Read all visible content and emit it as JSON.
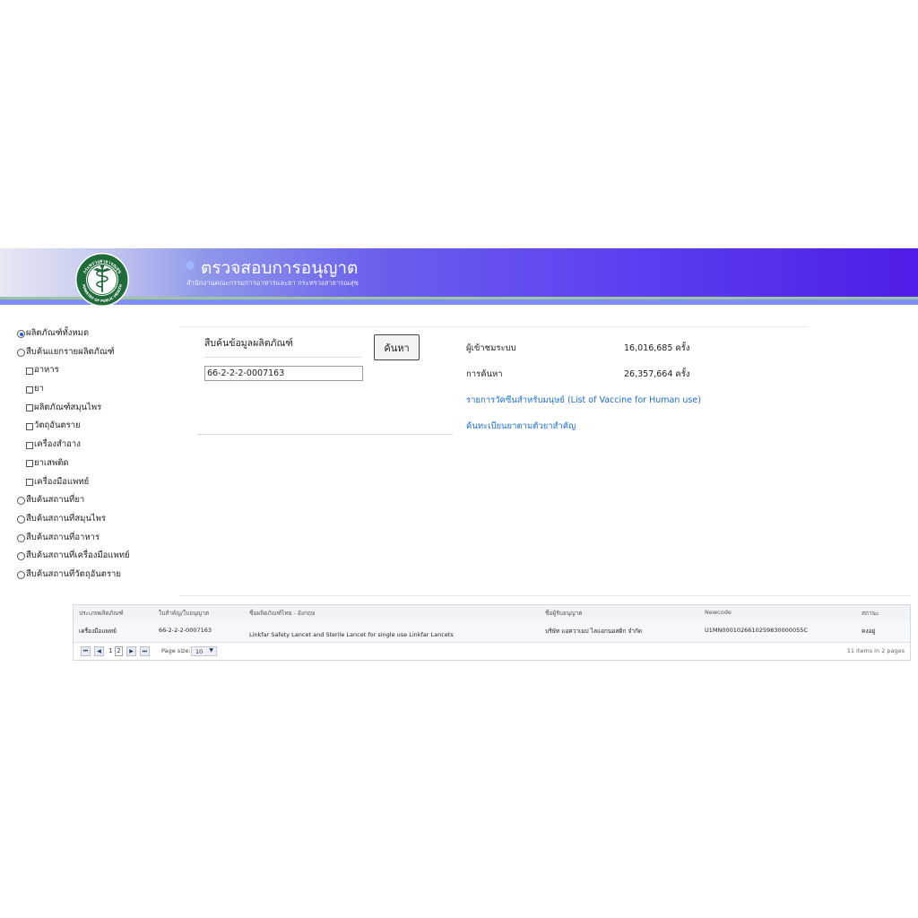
{
  "header": {
    "title": "ตรวจสอบการอนุญาต",
    "subtitle": "สำนักงานคณะกรรมการอาหารและยา กระทรวงสาธารณสุข",
    "logo_icon": "moph-seal-icon",
    "logo_text_top": "กระทรวงสาธารณสุข",
    "logo_text_bottom": "MINISTRY OF PUBLIC HEALTH"
  },
  "filters": {
    "items": [
      {
        "label": "ผลิตภัณฑ์ทั้งหมด",
        "control": "radio",
        "checked": true,
        "level": 0
      },
      {
        "label": "สืบค้นแยกรายผลิตภัณฑ์",
        "control": "radio",
        "checked": false,
        "level": 0
      },
      {
        "label": "อาหาร",
        "control": "checkbox",
        "checked": false,
        "level": 1
      },
      {
        "label": "ยา",
        "control": "checkbox",
        "checked": false,
        "level": 1
      },
      {
        "label": "ผลิตภัณฑ์สมุนไพร",
        "control": "checkbox",
        "checked": false,
        "level": 1
      },
      {
        "label": "วัตถุอันตราย",
        "control": "checkbox",
        "checked": false,
        "level": 1
      },
      {
        "label": "เครื่องสำอาง",
        "control": "checkbox",
        "checked": false,
        "level": 1
      },
      {
        "label": "ยาเสพติด",
        "control": "checkbox",
        "checked": false,
        "level": 1
      },
      {
        "label": "เครื่องมือแพทย์",
        "control": "checkbox",
        "checked": false,
        "level": 1
      },
      {
        "label": "สืบค้นสถานที่ยา",
        "control": "radio",
        "checked": false,
        "level": 0
      },
      {
        "label": "สืบค้นสถานที่สมุนไพร",
        "control": "radio",
        "checked": false,
        "level": 0
      },
      {
        "label": "สืบค้นสถานที่อาหาร",
        "control": "radio",
        "checked": false,
        "level": 0
      },
      {
        "label": "สืบค้นสถานที่เครื่องมือแพทย์",
        "control": "radio",
        "checked": false,
        "level": 0
      },
      {
        "label": "สืบค้นสถานที่วัตถุอันตราย",
        "control": "radio",
        "checked": false,
        "level": 0
      }
    ]
  },
  "search": {
    "label": "สืบค้นข้อมูลผลิตภัณฑ์",
    "value": "66-2-2-2-0007163",
    "button_label": "ค้นหา"
  },
  "stats": {
    "visitors_label": "ผู้เข้าชมระบบ",
    "visitors_value": "16,016,685 ครั้ง",
    "searches_label": "การค้นหา",
    "searches_value": "26,357,664 ครั้ง",
    "vaccine_link": "รายการวัคซีนสำหรับมนุษย์ (List of Vaccine for Human use)",
    "drug_link": "ค้นทะเบียนยาตามตัวยาสำคัญ"
  },
  "grid": {
    "columns": [
      "ประเภทผลิตภัณฑ์",
      "ใบสำคัญ/ใบอนุญาต",
      "ชื่อผลิตภัณฑ์ไทย - อังกฤษ",
      "ชื่อผู้รับอนุญาต",
      "Newcode",
      "สถานะ"
    ],
    "rows": [
      {
        "type": "เครื่องมือแพทย์",
        "license": "66-2-2-2-0007163",
        "name": "Linkfar Safety Lancet and Sterile Lancet for single use Linkfar Lancets",
        "licensee": "บริษัท แอควาเมป ไลแอกนอสติก จำกัด",
        "newcode": "U1MN0001026610259830000055C",
        "status": "คงอยู่"
      }
    ],
    "pager": {
      "first": "⏮",
      "prev": "◀",
      "pages": [
        "1",
        "2"
      ],
      "current_page": "2",
      "next": "▶",
      "last": "⏭",
      "page_size_label": "Page size:",
      "page_size": "10",
      "info": "11 items in 2 pages"
    }
  },
  "colors": {
    "banner_start": "#e6e8f6",
    "banner_end": "#4f1de8",
    "link": "#1a6fd1",
    "radio_selected": "#2f5bd6"
  }
}
